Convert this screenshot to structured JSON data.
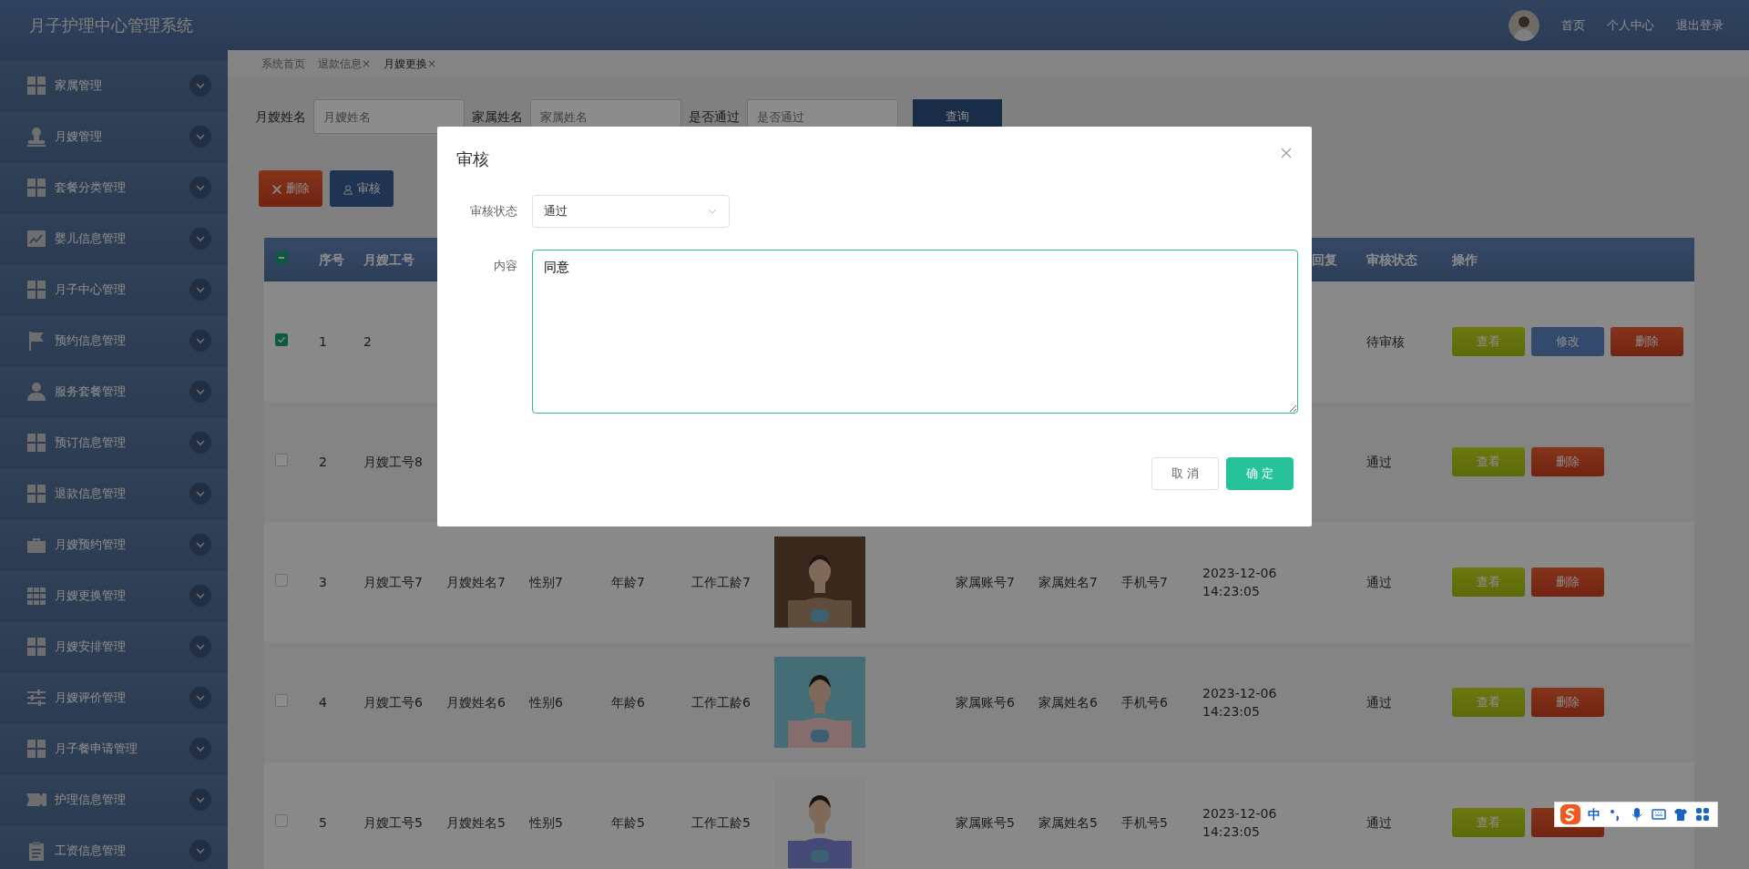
{
  "app_title": "月子护理中心管理系统",
  "top_nav": [
    {
      "label": "首页"
    },
    {
      "label": "个人中心"
    },
    {
      "label": "退出登录"
    }
  ],
  "sidebar": {
    "items": [
      {
        "label": "家属管理",
        "kind": "grid"
      },
      {
        "label": "月嫂管理",
        "kind": "stamp"
      },
      {
        "label": "套餐分类管理",
        "kind": "grid"
      },
      {
        "label": "婴儿信息管理",
        "kind": "chart"
      },
      {
        "label": "月子中心管理",
        "kind": "grid"
      },
      {
        "label": "预约信息管理",
        "kind": "flag"
      },
      {
        "label": "服务套餐管理",
        "kind": "user"
      },
      {
        "label": "预订信息管理",
        "kind": "grid"
      },
      {
        "label": "退款信息管理",
        "kind": "grid"
      },
      {
        "label": "月嫂预约管理",
        "kind": "briefcase"
      },
      {
        "label": "月嫂更换管理",
        "kind": "grid9"
      },
      {
        "label": "月嫂安排管理",
        "kind": "grid"
      },
      {
        "label": "月嫂评价管理",
        "kind": "sliders"
      },
      {
        "label": "月子餐申请管理",
        "kind": "grid"
      },
      {
        "label": "护理信息管理",
        "kind": "ticket"
      },
      {
        "label": "工资信息管理",
        "kind": "clipboard"
      }
    ]
  },
  "tabs": [
    {
      "label": "系统首页",
      "selected": false
    },
    {
      "label": "退款信息",
      "close": "×",
      "selected": false
    },
    {
      "label": "月嫂更换",
      "close": "×",
      "selected": true
    }
  ],
  "search": [
    {
      "label": "月嫂姓名",
      "placeholder": "月嫂姓名"
    },
    {
      "label": "家属姓名",
      "placeholder": "家属姓名"
    },
    {
      "label": "是否通过",
      "placeholder": "是否通过"
    }
  ],
  "search_button": {
    "label": "查询"
  },
  "toolbar": [
    {
      "label": "删除",
      "kind": "delete"
    },
    {
      "label": "审核",
      "kind": "review"
    }
  ],
  "table": {
    "header_checkbox": {
      "indeterminate": true
    },
    "columns_left": [
      {
        "label": "序号"
      },
      {
        "label": "月嫂工号"
      }
    ],
    "columns_right": [
      {
        "label": "回复"
      },
      {
        "label": "审核状态"
      },
      {
        "label": "操作"
      }
    ],
    "rows": [
      {
        "checked": true,
        "no": "1",
        "worker_id": "2",
        "status": "待审核",
        "actions": [
          {
            "label": "查看",
            "kind": "view"
          },
          {
            "label": "修改",
            "kind": "edit"
          },
          {
            "label": "删除",
            "kind": "delete"
          }
        ]
      },
      {
        "checked": false,
        "no": "2",
        "worker_id": "月嫂工号8",
        "status": "通过",
        "actions": [
          {
            "label": "查看",
            "kind": "view"
          },
          {
            "label": "删除",
            "kind": "delete"
          }
        ]
      },
      {
        "checked": false,
        "no": "3",
        "worker_id": "月嫂工号7",
        "worker_name": "月嫂姓名7",
        "gender": "性别7",
        "age": "年龄7",
        "years": "工作工龄7",
        "photo": {
          "kind": "picture"
        },
        "family_account": "家属账号7",
        "family_name": "家属姓名7",
        "phone": "手机号7",
        "time": "2023-12-06 14:23:05",
        "status": "通过",
        "actions": [
          {
            "label": "查看",
            "kind": "view"
          },
          {
            "label": "删除",
            "kind": "delete"
          }
        ]
      },
      {
        "checked": false,
        "no": "4",
        "worker_id": "月嫂工号6",
        "worker_name": "月嫂姓名6",
        "gender": "性别6",
        "age": "年龄6",
        "years": "工作工龄6",
        "photo": {
          "kind": "picture"
        },
        "family_account": "家属账号6",
        "family_name": "家属姓名6",
        "phone": "手机号6",
        "time": "2023-12-06 14:23:05",
        "status": "通过",
        "actions": [
          {
            "label": "查看",
            "kind": "view"
          },
          {
            "label": "删除",
            "kind": "delete"
          }
        ]
      },
      {
        "checked": false,
        "no": "5",
        "worker_id": "月嫂工号5",
        "worker_name": "月嫂姓名5",
        "gender": "性别5",
        "age": "年龄5",
        "years": "工作工龄5",
        "photo": {
          "kind": "picture"
        },
        "family_account": "家属账号5",
        "family_name": "家属姓名5",
        "phone": "手机号5",
        "time": "2023-12-06 14:23:05",
        "status": "通过",
        "actions": [
          {
            "label": "查看",
            "kind": "view"
          },
          {
            "kind": "delete"
          }
        ]
      }
    ]
  },
  "dialog": {
    "title": "审核",
    "fields": [
      {
        "label": "审核状态",
        "kind": "select",
        "value": "通过"
      },
      {
        "label": "内容",
        "kind": "textarea",
        "value": "同意"
      }
    ],
    "buttons": [
      {
        "label": "取 消",
        "kind": "cancel"
      },
      {
        "label": "确 定",
        "kind": "primary"
      }
    ]
  },
  "ime_bar": {
    "label": "中"
  }
}
